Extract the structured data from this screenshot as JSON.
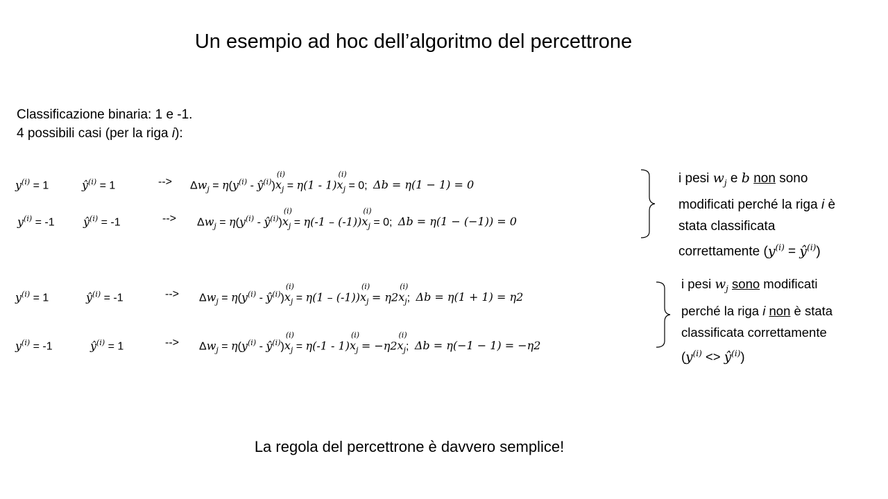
{
  "title": "Un esempio ad hoc dell’algoritmo del percettrone",
  "intro": {
    "line1": "Classificazione binaria: 1 e -1.",
    "line2_prefix": "4 possibili casi (per la riga ",
    "line2_var": "i",
    "line2_suffix": "):"
  },
  "cases": [
    {
      "y_val": "= 1",
      "yhat_val": "= 1",
      "arrow": "-->",
      "bracket": "η(1 - 1)",
      "result": "= 0;",
      "db": "Δb = η(1 − 1) = 0"
    },
    {
      "y_val": "= -1",
      "yhat_val": "= -1",
      "arrow": "-->",
      "bracket": "η(-1 – (-1))",
      "result": "= 0;",
      "db": "Δb = η(1 − (−1)) = 0"
    },
    {
      "y_val": "= 1",
      "yhat_val": "= -1",
      "arrow": "-->",
      "bracket": "η(1 – (-1))",
      "result": "= η2",
      "db": "Δb = η(1 + 1) = η2"
    },
    {
      "y_val": "= -1",
      "yhat_val": "= 1",
      "arrow": "-->",
      "bracket": "η(-1 - 1)",
      "result": "= −η2",
      "db": "Δb = η(−1 − 1) = −η2"
    }
  ],
  "note_unchanged": {
    "a": "i pesi ",
    "w": "w",
    "j": "j",
    "e": " e ",
    "b": "b",
    "non": "non",
    "sono": " sono",
    "line2_a": "modificati perché la riga ",
    "line2_i": "i",
    "line2_b": " è",
    "line3": "stata classificata",
    "line4_a": "correttamente (",
    "line4_eq": " = ",
    "line4_end": ")"
  },
  "note_changed": {
    "a": "i pesi ",
    "w": "w",
    "j": "j",
    "space": " ",
    "sono": "sono",
    "mod": " modificati",
    "line2_a": "perché la riga ",
    "line2_i": "i",
    "line2_sp": " ",
    "non": "non",
    "line2_b": " è stata",
    "line3": "classificata correttamente",
    "line4_a": "(",
    "line4_ne": " <> ",
    "line4_end": ")"
  },
  "footer": "La regola del percettrone è davvero semplice!"
}
